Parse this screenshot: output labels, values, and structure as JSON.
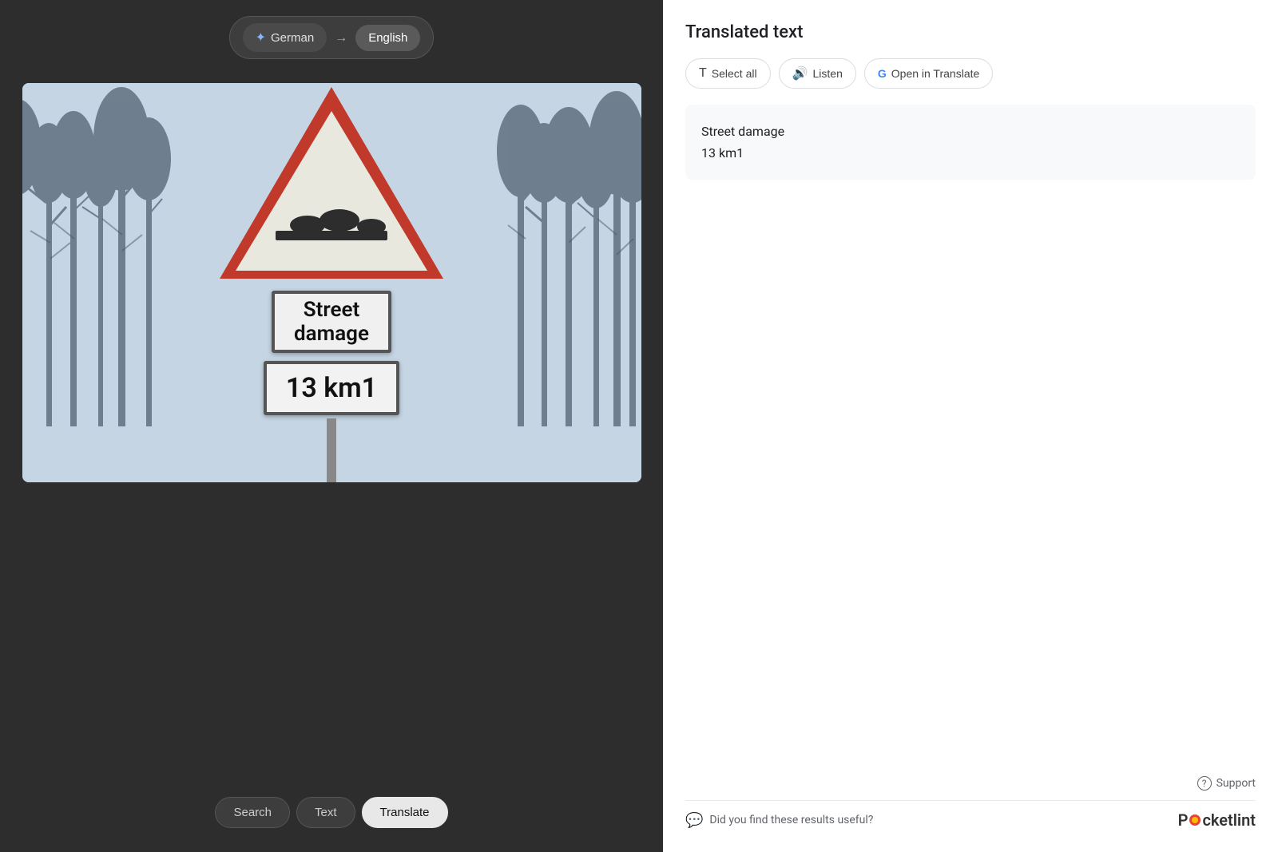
{
  "left": {
    "language_bar": {
      "source_lang": "German",
      "arrow": "→",
      "target_lang": "English"
    },
    "sign": {
      "line1": "Street",
      "line2": "damage",
      "line3": "13 km1"
    },
    "bottom_nav": {
      "items": [
        {
          "label": "Search",
          "active": false
        },
        {
          "label": "Text",
          "active": false
        },
        {
          "label": "Translate",
          "active": true
        }
      ]
    }
  },
  "right": {
    "title": "Translated text",
    "actions": [
      {
        "label": "Select all",
        "icon": "T"
      },
      {
        "label": "Listen",
        "icon": "🔊"
      },
      {
        "label": "Open in Translate",
        "icon": "G"
      }
    ],
    "translated": {
      "line1": "Street damage",
      "line2": "13 km1"
    },
    "footer": {
      "support_label": "Support",
      "feedback_question": "Did you find these results useful?",
      "brand": "Pocketlint"
    }
  }
}
